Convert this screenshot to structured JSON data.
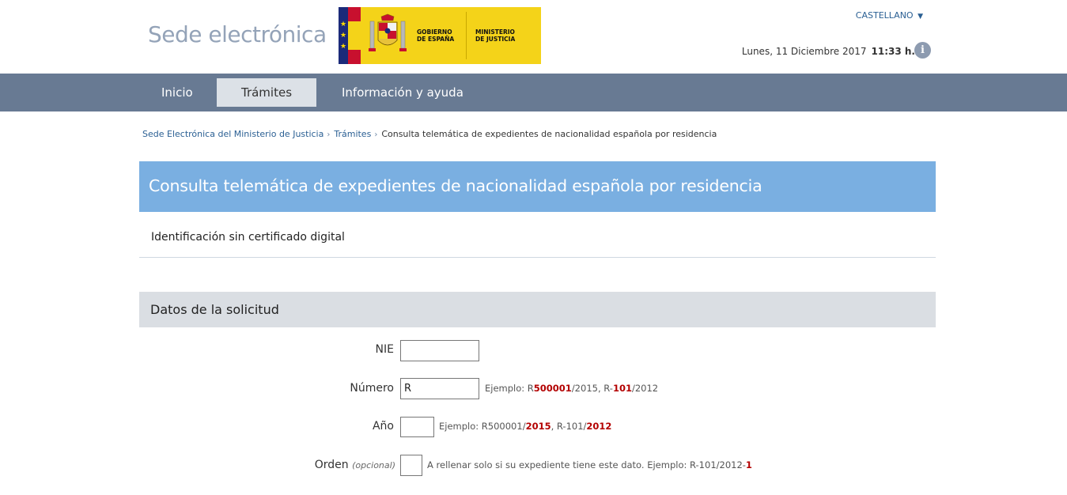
{
  "header": {
    "site_title": "Sede electrónica",
    "logo": {
      "text_left": [
        "GOBIERNO",
        "DE ESPAÑA"
      ],
      "text_right": [
        "MINISTERIO",
        "DE JUSTICIA"
      ],
      "colors": {
        "yellow": "#f4d319",
        "red": "#c8102e",
        "blue": "#1b2a7a"
      }
    },
    "language": "CASTELLANO",
    "date": "Lunes, 11 Diciembre 2017",
    "time": "11:33 h.",
    "info_icon": "info-icon"
  },
  "nav": {
    "items": [
      {
        "label": "Inicio",
        "active": false
      },
      {
        "label": "Trámites",
        "active": true
      },
      {
        "label": "Información y ayuda",
        "active": false
      }
    ]
  },
  "breadcrumb": {
    "items": [
      "Sede Electrónica del Ministerio de Justicia",
      "Trámites"
    ],
    "separator": "›",
    "current": "Consulta telemática de expedientes de nacionalidad española por residencia"
  },
  "page": {
    "title": "Consulta telemática de expedientes de nacionalidad española por residencia",
    "identification": "Identificación sin certificado digital",
    "section_title": "Datos de la solicitud"
  },
  "form": {
    "nie": {
      "label": "NIE",
      "value": ""
    },
    "numero": {
      "label": "Número",
      "value": "R",
      "hint": {
        "prefix": "Ejemplo: R",
        "num1": "500001",
        "mid": "/2015, R-",
        "num2": "101",
        "suffix": "/2012"
      }
    },
    "anio": {
      "label": "Año",
      "value": "",
      "hint": {
        "prefix": "Ejemplo: R500001/",
        "y1": "2015",
        "mid": ", R-101/",
        "y2": "2012"
      }
    },
    "orden": {
      "label": "Orden",
      "optional": "(opcional)",
      "value": "",
      "hint": {
        "text": "A rellenar solo si su expediente tiene este dato. Ejemplo: R-101/2012-",
        "hl": "1"
      }
    }
  },
  "colors": {
    "nav_bg": "#687a93",
    "header_bar": "#7aafe1",
    "section_bg": "#dadee3",
    "link": "#2a5f93",
    "highlight": "#b30000"
  }
}
